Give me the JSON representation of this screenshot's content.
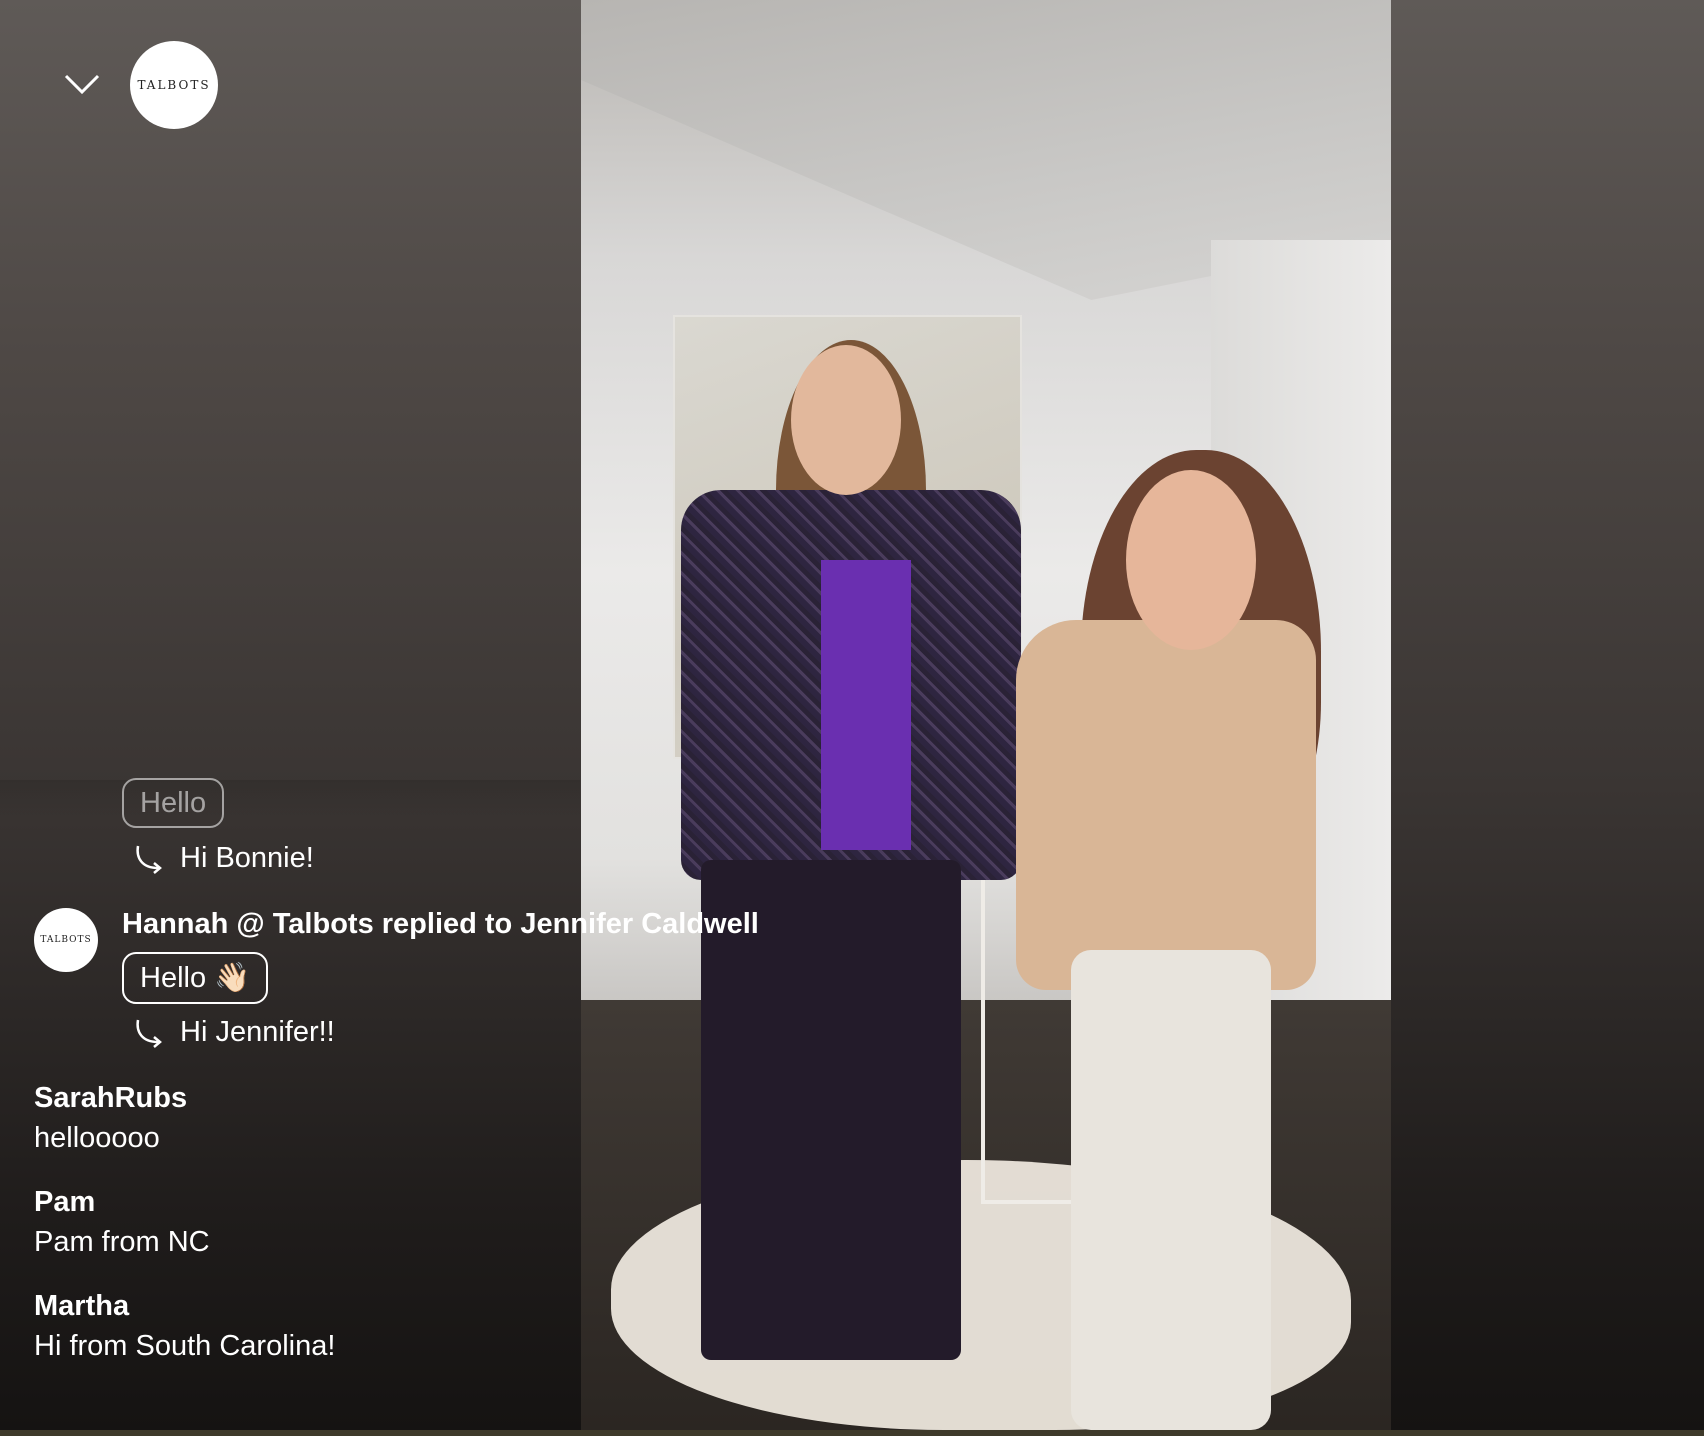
{
  "header": {
    "collapse_icon": "chevron-down-icon",
    "brand_logo_text": "TALBOTS"
  },
  "chat": {
    "partial_top": {
      "reaction_pill": "Hello",
      "reply_text": "Hi Bonnie!"
    },
    "replied_message": {
      "avatar_text": "TALBOTS",
      "header": "Hannah @ Talbots replied to Jennifer Caldwell",
      "reaction_pill": "Hello 👋🏻",
      "reply_text": "Hi Jennifer!!"
    },
    "messages": [
      {
        "author": "SarahRubs",
        "text": "hellooooo"
      },
      {
        "author": "Pam",
        "text": "Pam from NC"
      },
      {
        "author": "Martha",
        "text": "Hi from South Carolina!"
      }
    ]
  },
  "colors": {
    "panel_top": "#5f5a57",
    "panel_bottom": "#151312",
    "text": "#ffffff"
  }
}
